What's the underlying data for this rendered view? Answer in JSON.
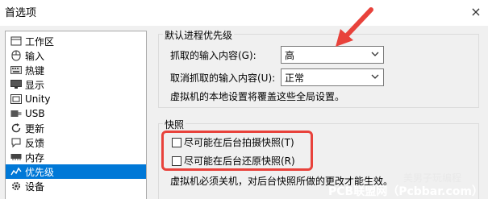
{
  "window": {
    "title": "首选项",
    "close_glyph": "×"
  },
  "sidebar": {
    "items": [
      {
        "label": "工作区",
        "icon": "workspace-icon"
      },
      {
        "label": "输入",
        "icon": "mouse-icon"
      },
      {
        "label": "热键",
        "icon": "keyboard-icon"
      },
      {
        "label": "显示",
        "icon": "monitor-icon"
      },
      {
        "label": "Unity",
        "icon": "unity-icon"
      },
      {
        "label": "USB",
        "icon": "usb-icon"
      },
      {
        "label": "更新",
        "icon": "refresh-icon"
      },
      {
        "label": "反馈",
        "icon": "feedback-icon"
      },
      {
        "label": "内存",
        "icon": "memory-icon"
      },
      {
        "label": "优先级",
        "icon": "priority-icon",
        "selected": true
      },
      {
        "label": "设备",
        "icon": "gear-icon"
      }
    ]
  },
  "priority_group": {
    "title": "默认进程优先级",
    "grab_label": "抓取的输入内容(G):",
    "grab_value": "高",
    "ungrab_label": "取消抓取的输入内容(U):",
    "ungrab_value": "正常",
    "note": "虚拟机的本地设置将覆盖这些全局设置。"
  },
  "snapshot_group": {
    "title": "快照",
    "take_label": "尽可能在后台拍摄快照(T)",
    "restore_label": "尽可能在后台还原快照(R)",
    "note": "虚拟机必须关机，对后台快照所做的更改才能生效。"
  },
  "overlay": {
    "wechat_name": "美男子玩编程",
    "site_text": "PCB联盟网（Pcbbar.com）",
    "arrow_color": "#e8423b",
    "highlight_color": "#e8423b",
    "accent": "#0078d7"
  }
}
